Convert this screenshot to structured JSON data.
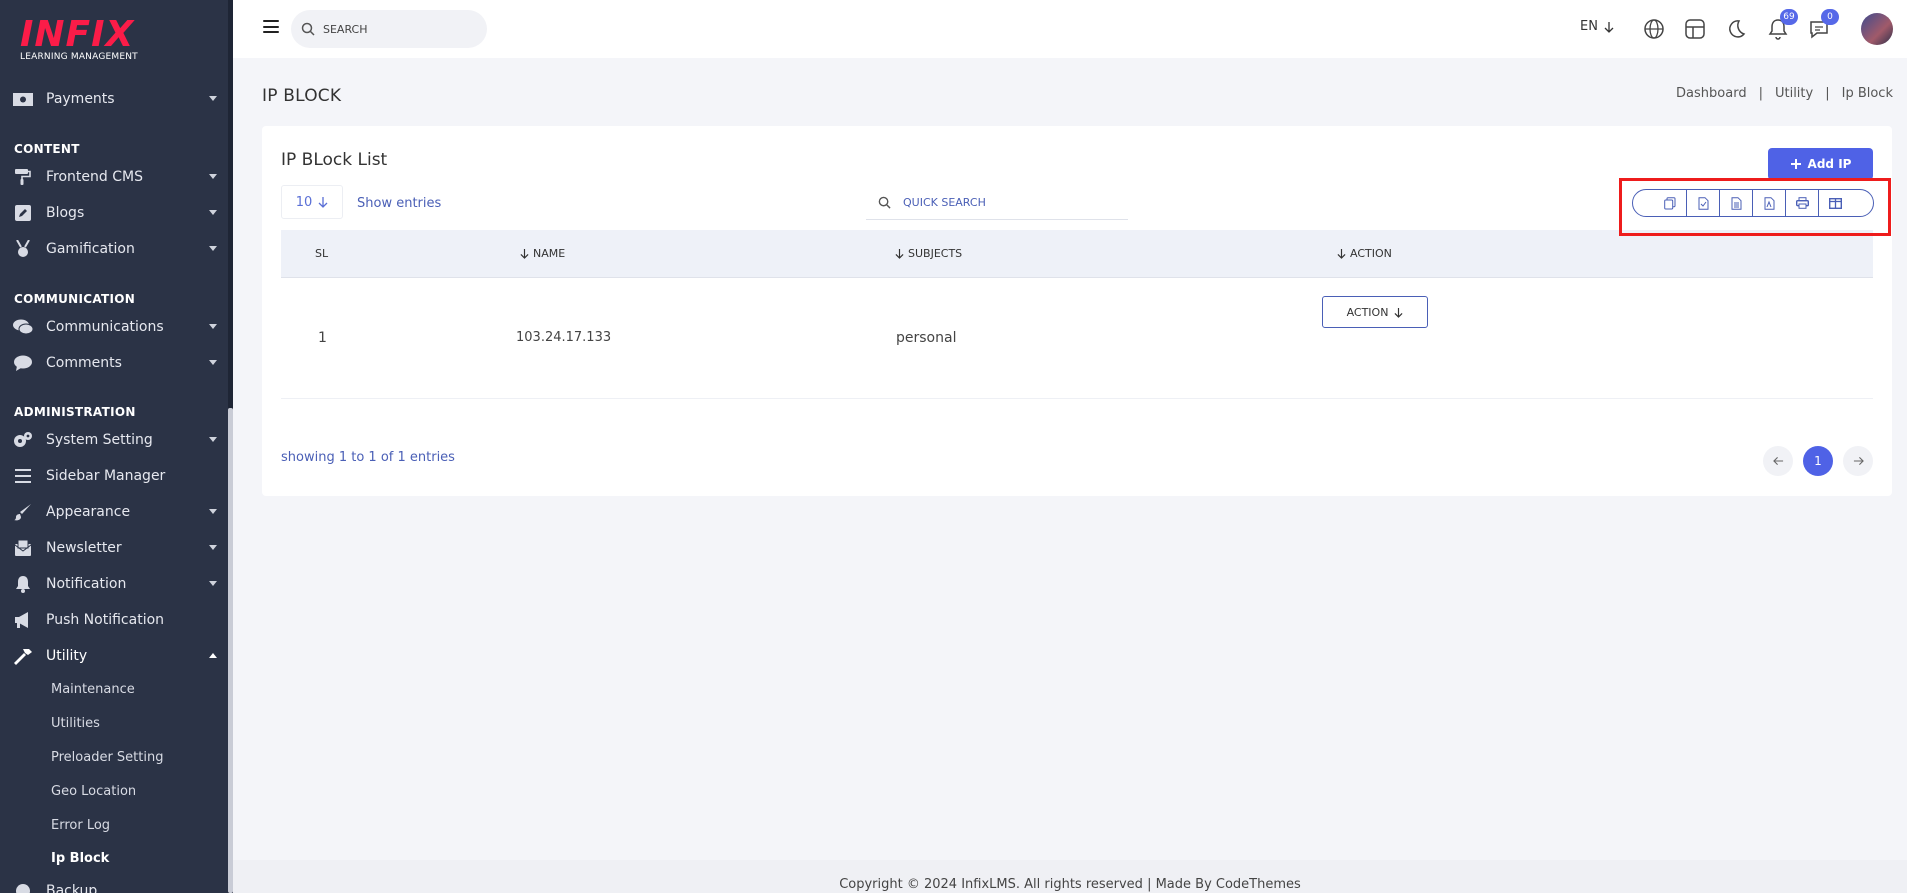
{
  "brand": {
    "logo_text": "INFIX",
    "logo_sub": "LEARNING MANAGEMENT",
    "logo_color": "#fb1c48"
  },
  "sidebar": {
    "headings": {
      "content": "CONTENT",
      "communication": "COMMUNICATION",
      "administration": "ADMINISTRATION"
    },
    "items": {
      "payments": "Payments",
      "frontend_cms": "Frontend CMS",
      "blogs": "Blogs",
      "gamification": "Gamification",
      "communications": "Communications",
      "comments": "Comments",
      "system_setting": "System Setting",
      "sidebar_manager": "Sidebar Manager",
      "appearance": "Appearance",
      "newsletter": "Newsletter",
      "notification": "Notification",
      "push_notification": "Push Notification",
      "utility": "Utility",
      "backup": "Backup"
    },
    "utility_sub": {
      "maintenance": "Maintenance",
      "utilities": "Utilities",
      "preloader_setting": "Preloader Setting",
      "geo_location": "Geo Location",
      "error_log": "Error Log",
      "ip_block": "Ip Block"
    }
  },
  "header": {
    "search_placeholder": "SEARCH",
    "language": "EN",
    "notification_count": "69",
    "message_count": "0"
  },
  "page": {
    "title": "IP BLOCK",
    "breadcrumb": {
      "dashboard": "Dashboard",
      "utility": "Utility",
      "current": "Ip Block"
    }
  },
  "card": {
    "title": "IP BLock List",
    "add_button": "Add IP",
    "entries_value": "10",
    "entries_label": "Show entries",
    "quick_search_placeholder": "QUICK SEARCH",
    "export_icons": [
      "copy-icon",
      "csv-icon",
      "excel-icon",
      "pdf-icon",
      "print-icon",
      "columns-icon"
    ],
    "columns": {
      "sl": "SL",
      "name": "NAME",
      "subjects": "SUBJECTS",
      "action": "ACTION"
    },
    "rows": [
      {
        "sl": "1",
        "name": "103.24.17.133",
        "subjects": "personal",
        "action": "ACTION"
      }
    ],
    "showing": "showing 1 to 1 of 1 entries",
    "current_page": "1"
  },
  "footer": {
    "text": "Copyright © 2024 InfixLMS. All rights reserved | Made By CodeThemes"
  },
  "colors": {
    "accent": "#4f62e6",
    "sidebar_bg": "#2b3346",
    "highlight": "#ee1c1c"
  }
}
